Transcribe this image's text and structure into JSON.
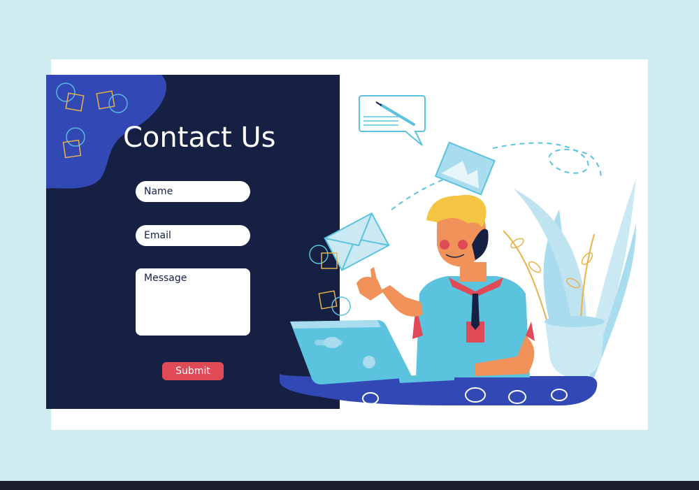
{
  "contact": {
    "title": "Contact Us",
    "name_placeholder": "Name",
    "email_placeholder": "Email",
    "message_placeholder": "Message",
    "submit_label": "Submit"
  },
  "colors": {
    "background": "#cfecf1",
    "panel": "#152043",
    "blob": "#3248b4",
    "accent": "#e04a56",
    "illustration_blue": "#5bc3dd"
  },
  "icons": [
    "chat-bubble-icon",
    "pencil-icon",
    "photo-icon",
    "envelope-icon",
    "laptop-icon",
    "plant-icon"
  ]
}
